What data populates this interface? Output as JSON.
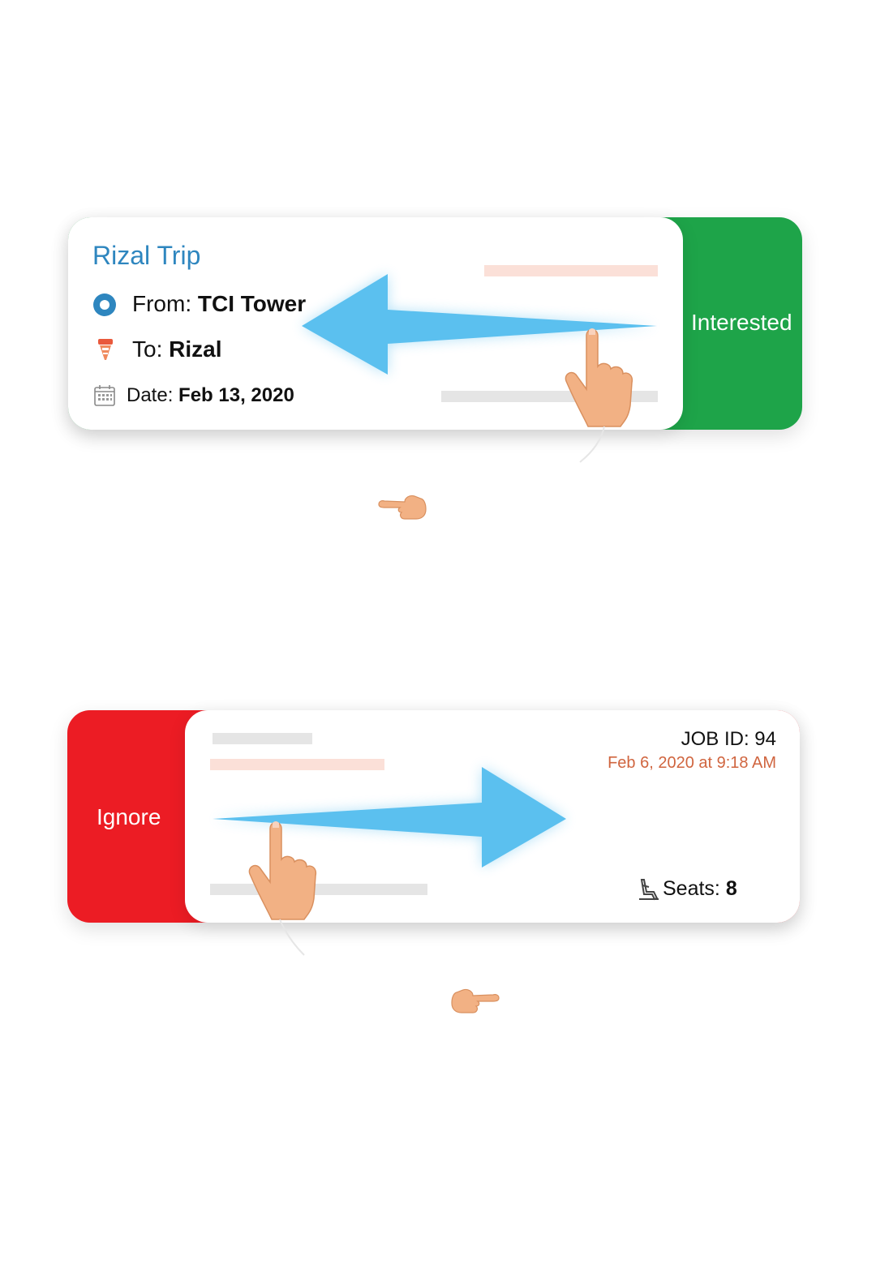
{
  "card_interested": {
    "title": "Rizal Trip",
    "from_prefix": "From: ",
    "from_value": "TCI Tower",
    "to_prefix": "To: ",
    "to_value": "Rizal",
    "date_prefix": "Date: ",
    "date_value": "Feb 13, 2020",
    "action_label": "Interested",
    "action_color": "#1ea449",
    "title_color": "#2e86bf",
    "icons": [
      "origin-dot-icon",
      "destination-pin-icon",
      "calendar-icon",
      "swipe-left-arrow-icon",
      "hand-pointer-icon"
    ]
  },
  "card_ignore": {
    "job_id": "JOB ID: 94",
    "timestamp": "Feb 6, 2020 at 9:18 AM",
    "seats_prefix": "Seats: ",
    "seats_value": "8",
    "action_label": "Ignore",
    "action_color": "#ec1c24",
    "timestamp_color": "#d0653f",
    "icons": [
      "seat-icon",
      "swipe-right-arrow-icon",
      "hand-pointer-icon"
    ]
  },
  "arrow_color": "#5bc0ef",
  "skin_color": "#f2b184"
}
